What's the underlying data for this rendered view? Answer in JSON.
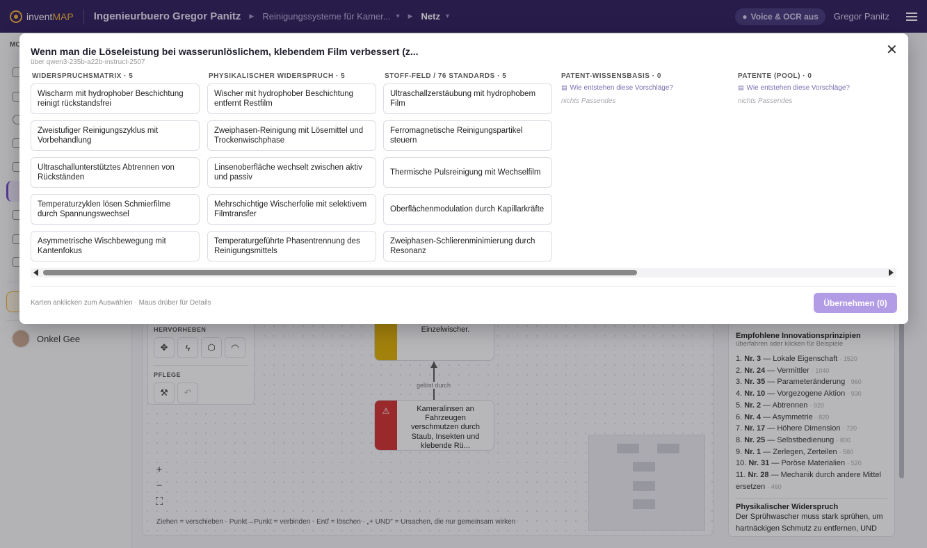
{
  "topbar": {
    "brand_a": "invent",
    "brand_b": "MAP",
    "project": "Ingenieurbuero Gregor Panitz",
    "crumb": "Reinigungssysteme für Kamer...",
    "view": "Netz",
    "voice_label": "Voice & OCR aus",
    "user": "Gregor Panitz"
  },
  "sidebar": {
    "section_label": "MO",
    "person": "Onkel Gee"
  },
  "tools": {
    "highlight_label": "HERVORHEBEN",
    "care_label": "PFLEGE"
  },
  "canvas": {
    "node_top": "Einzelwischer.",
    "node_bottom": "Kameralinsen an Fahrzeugen verschmutzen durch Staub, Insekten und klebende Rü...",
    "edge_label": "gelöst durch",
    "hint": "Ziehen = verschieben · Punkt→Punkt = verbinden · Entf = löschen · „+ UND\" = Ursachen, die nur gemeinsam wirken"
  },
  "principles": {
    "title": "Empfohlene Innovationsprinzipien",
    "subtitle": "überfahren oder klicken für Beispiele",
    "items": [
      {
        "idx": "1.",
        "nr": "Nr. 3",
        "name": "Lokale Eigenschaft",
        "count": "1520"
      },
      {
        "idx": "2.",
        "nr": "Nr. 24",
        "name": "Vermittler",
        "count": "1040"
      },
      {
        "idx": "3.",
        "nr": "Nr. 35",
        "name": "Parameteränderung",
        "count": "960"
      },
      {
        "idx": "4.",
        "nr": "Nr. 10",
        "name": "Vorgezogene Aktion",
        "count": "930"
      },
      {
        "idx": "5.",
        "nr": "Nr. 2",
        "name": "Abtrennen",
        "count": "920"
      },
      {
        "idx": "6.",
        "nr": "Nr. 4",
        "name": "Asymmetrie",
        "count": "820"
      },
      {
        "idx": "7.",
        "nr": "Nr. 17",
        "name": "Höhere Dimension",
        "count": "720"
      },
      {
        "idx": "8.",
        "nr": "Nr. 25",
        "name": "Selbstbedienung",
        "count": "600"
      },
      {
        "idx": "9.",
        "nr": "Nr. 1",
        "name": "Zerlegen, Zerteilen",
        "count": "580"
      },
      {
        "idx": "10.",
        "nr": "Nr. 31",
        "name": "Poröse Materialien",
        "count": "520"
      },
      {
        "idx": "11.",
        "nr": "Nr. 28",
        "name": "Mechanik durch andere Mittel ersetzen",
        "count": "460"
      }
    ],
    "contradiction_title": "Physikalischer Widerspruch",
    "contradiction_text": "Der Sprühwascher muss stark sprühen, um hartnäckigen Schmutz zu entfernen, UND muss sanft sprühen, um Schlieren"
  },
  "modal": {
    "title": "Wenn man die Löseleistung bei wasserunlöslichem, klebendem Film verbessert (z...",
    "subtitle": "über qwen3-235b-a22b-instruct-2507",
    "close": "✕",
    "columns": [
      {
        "header": "WIDERSPRUCHSMATRIX · 5",
        "cards": [
          "Wischarm mit hydrophober Beschichtung reinigt rückstandsfrei",
          "Zweistufiger Reinigungszyklus mit Vorbehandlung",
          "Ultraschallunterstütztes Abtrennen von Rückständen",
          "Temperaturzyklen lösen Schmierfilme durch Spannungswechsel",
          "Asymmetrische Wischbewegung mit Kantenfokus"
        ]
      },
      {
        "header": "PHYSIKALISCHER WIDERSPRUCH · 5",
        "cards": [
          "Wischer mit hydrophober Beschichtung entfernt Restfilm",
          "Zweiphasen-Reinigung mit Lösemittel und Trockenwischphase",
          "Linsenoberfläche wechselt zwischen aktiv und passiv",
          "Mehrschichtige Wischerfolie mit selektivem Filmtransfer",
          "Temperaturgeführte Phasentrennung des Reinigungsmittels"
        ]
      },
      {
        "header": "STOFF-FELD / 76 STANDARDS · 5",
        "cards": [
          "Ultraschallzerstäubung mit hydrophobem Film",
          "Ferromagnetische Reinigungspartikel steuern",
          "Thermische Pulsreinigung mit Wechselfilm",
          "Oberflächenmodulation durch Kapillarkräfte",
          "Zweiphasen-Schlierenminimierung durch Resonanz"
        ]
      },
      {
        "header": "PATENT-WISSENSBASIS · 0",
        "question": "Wie entstehen diese Vorschläge?",
        "empty": "nichts Passendes"
      },
      {
        "header": "PATENTE (POOL) · 0",
        "question": "Wie entstehen diese Vorschläge?",
        "empty": "nichts Passendes"
      }
    ],
    "footer_hint": "Karten anklicken zum Auswählen · Maus drüber für Details",
    "apply_label": "Übernehmen (0)"
  }
}
